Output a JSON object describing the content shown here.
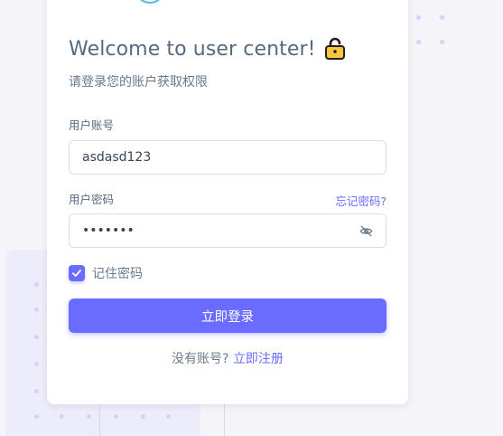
{
  "colors": {
    "primary": "#696cff",
    "heading": "#566a7f",
    "body_text": "#697a8d",
    "border": "#d9dee3",
    "page_bg": "#f5f5f9"
  },
  "card": {
    "logo_icon": "brand-logo-icon"
  },
  "header": {
    "title": "Welcome to user center!",
    "title_icon": "lock-icon",
    "subtitle": "请登录您的账户获取权限"
  },
  "form": {
    "account_label": "用户账号",
    "account_value": "asdasd123",
    "password_label": "用户密码",
    "forgot_label": "忘记密码?",
    "password_value": "•••••••",
    "password_toggle_icon": "eye-off-icon",
    "remember_label": "记住密码",
    "remember_checked": true,
    "submit_label": "立即登录"
  },
  "footer": {
    "no_account_text": "没有账号?",
    "register_label": "立即注册"
  }
}
